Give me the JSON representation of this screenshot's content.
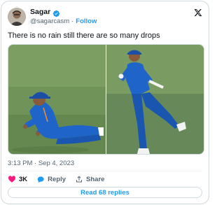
{
  "tweet": {
    "author": {
      "display_name": "Sagar",
      "handle": "@sagarcasm",
      "verified": true
    },
    "follow_label": "Follow",
    "separator": "·",
    "text": "There is no rain still there are so many drops",
    "timestamp": "3:13 PM · Sep 4, 2023",
    "actions": {
      "like_count": "3K",
      "reply_label": "Reply",
      "share_label": "Share"
    },
    "read_replies_label": "Read 68 replies"
  },
  "icons": {
    "verified": "verified-badge-icon",
    "platform": "x-logo-icon",
    "like": "heart-icon",
    "reply": "speech-bubble-icon",
    "share": "share-arrow-icon"
  },
  "colors": {
    "accent": "#1d9bf0",
    "like": "#f91880",
    "text_primary": "#0f1419",
    "text_secondary": "#536471",
    "border": "#cfd9de"
  }
}
